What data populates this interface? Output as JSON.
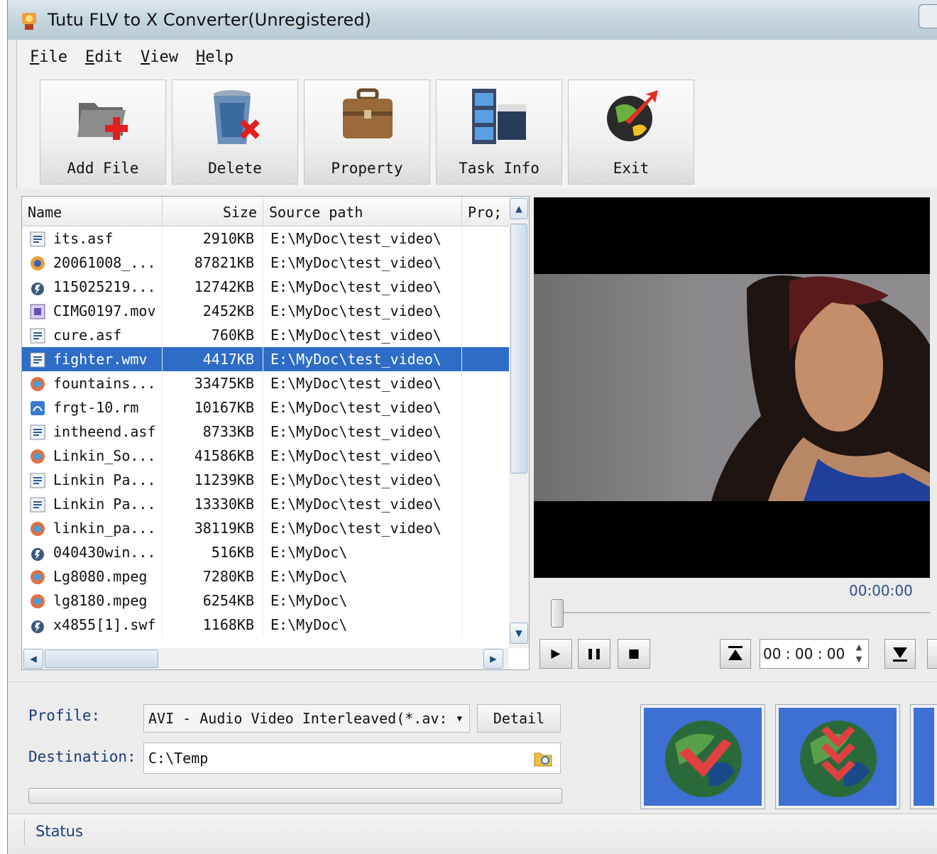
{
  "window": {
    "title": "Tutu FLV to X Converter(Unregistered)"
  },
  "menu": [
    {
      "label": "File",
      "u": "F",
      "rest": "ile"
    },
    {
      "label": "Edit",
      "u": "E",
      "rest": "dit"
    },
    {
      "label": "View",
      "u": "V",
      "rest": "iew"
    },
    {
      "label": "Help",
      "u": "H",
      "rest": "elp"
    }
  ],
  "toolbar": {
    "add_file": "Add File",
    "delete": "Delete",
    "property": "Property",
    "task_info": "Task Info",
    "exit": "Exit"
  },
  "filelist": {
    "columns": [
      "Name",
      "Size",
      "Source path",
      "Pro;"
    ],
    "rows": [
      {
        "name": "its.asf",
        "size": "2910KB",
        "path": "E:\\MyDoc\\test_video\\",
        "icon": "wmv-file-icon"
      },
      {
        "name": "20061008_...",
        "size": "87821KB",
        "path": "E:\\MyDoc\\test_video\\",
        "icon": "avi-file-icon"
      },
      {
        "name": "115025219...",
        "size": "12742KB",
        "path": "E:\\MyDoc\\test_video\\",
        "icon": "flash-file-icon"
      },
      {
        "name": "CIMG0197.mov",
        "size": "2452KB",
        "path": "E:\\MyDoc\\test_video\\",
        "icon": "mov-file-icon"
      },
      {
        "name": "cure.asf",
        "size": "760KB",
        "path": "E:\\MyDoc\\test_video\\",
        "icon": "wmv-file-icon"
      },
      {
        "name": "fighter.wmv",
        "size": "4417KB",
        "path": "E:\\MyDoc\\test_video\\",
        "icon": "wmv-file-icon",
        "selected": true
      },
      {
        "name": "fountains...",
        "size": "33475KB",
        "path": "E:\\MyDoc\\test_video\\",
        "icon": "mpeg-file-icon"
      },
      {
        "name": "frgt-10.rm",
        "size": "10167KB",
        "path": "E:\\MyDoc\\test_video\\",
        "icon": "real-file-icon"
      },
      {
        "name": "intheend.asf",
        "size": "8733KB",
        "path": "E:\\MyDoc\\test_video\\",
        "icon": "wmv-file-icon"
      },
      {
        "name": "Linkin_So...",
        "size": "41586KB",
        "path": "E:\\MyDoc\\test_video\\",
        "icon": "mpeg-file-icon"
      },
      {
        "name": "Linkin Pa...",
        "size": "11239KB",
        "path": "E:\\MyDoc\\test_video\\",
        "icon": "wmv-file-icon"
      },
      {
        "name": "Linkin Pa...",
        "size": "13330KB",
        "path": "E:\\MyDoc\\test_video\\",
        "icon": "wmv-file-icon"
      },
      {
        "name": "linkin_pa...",
        "size": "38119KB",
        "path": "E:\\MyDoc\\test_video\\",
        "icon": "mpeg-file-icon"
      },
      {
        "name": "040430win...",
        "size": "516KB",
        "path": "E:\\MyDoc\\",
        "icon": "flash-file-icon"
      },
      {
        "name": "Lg8080.mpeg",
        "size": "7280KB",
        "path": "E:\\MyDoc\\",
        "icon": "mpeg-file-icon"
      },
      {
        "name": "lg8180.mpeg",
        "size": "6254KB",
        "path": "E:\\MyDoc\\",
        "icon": "mpeg-file-icon"
      },
      {
        "name": "x4855[1].swf",
        "size": "1168KB",
        "path": "E:\\MyDoc\\",
        "icon": "flash-file-icon"
      }
    ]
  },
  "player": {
    "time_label": "00:00:00",
    "start_time": "00 : 00 : 00",
    "play": "▶",
    "pause": "❚❚",
    "stop": "■"
  },
  "bottom": {
    "profile_label": "Profile:",
    "profile_value": "AVI - Audio Video Interleaved(*.av:",
    "detail": "Detail",
    "destination_label": "Destination:",
    "destination_value": "C:\\Temp"
  },
  "status": {
    "text": "Status"
  },
  "colors": {
    "selection": "#2d6cc7",
    "accent_blue": "#3e6fd3",
    "label_blue": "#1a3e78"
  }
}
